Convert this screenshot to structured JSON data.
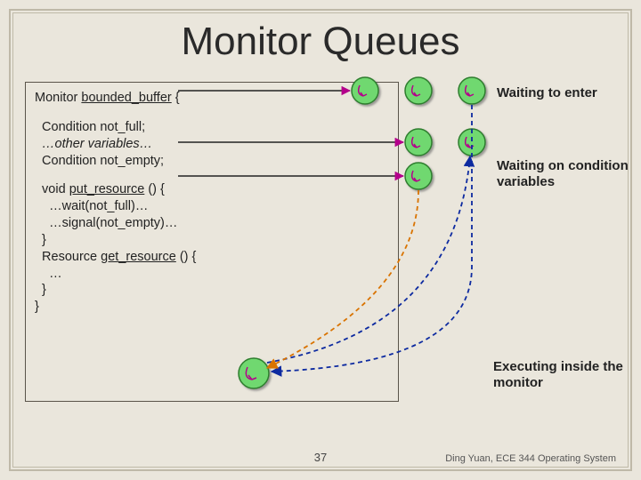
{
  "title": "Monitor Queues",
  "code": {
    "l1_a": "Monitor ",
    "l1_b": "bounded_buffer",
    "l1_c": " {",
    "l2": "  Condition not_full;",
    "l3": "  …other variables…",
    "l4": "  Condition not_empty;",
    "l5_a": "  void ",
    "l5_b": "put_resource",
    "l5_c": " () {",
    "l6": "    …wait(not_full)…",
    "l7": "    …signal(not_empty)…",
    "l8": "  }",
    "l9_a": "  Resource ",
    "l9_b": "get_resource",
    "l9_c": " () {",
    "l10": "    …",
    "l11": "  }",
    "l12": "}"
  },
  "labels": {
    "waiting_enter": "Waiting to enter",
    "waiting_cond": "Waiting on condition variables",
    "executing": "Executing inside the monitor"
  },
  "slide_number": "37",
  "credit": "Ding Yuan, ECE 344 Operating System",
  "colors": {
    "circle_fill": "#6fd86f",
    "circle_stroke": "#2e7d2e",
    "arrow_magenta": "#b4008b",
    "dash_blue": "#0d2aa0",
    "dash_orange": "#d97300"
  }
}
